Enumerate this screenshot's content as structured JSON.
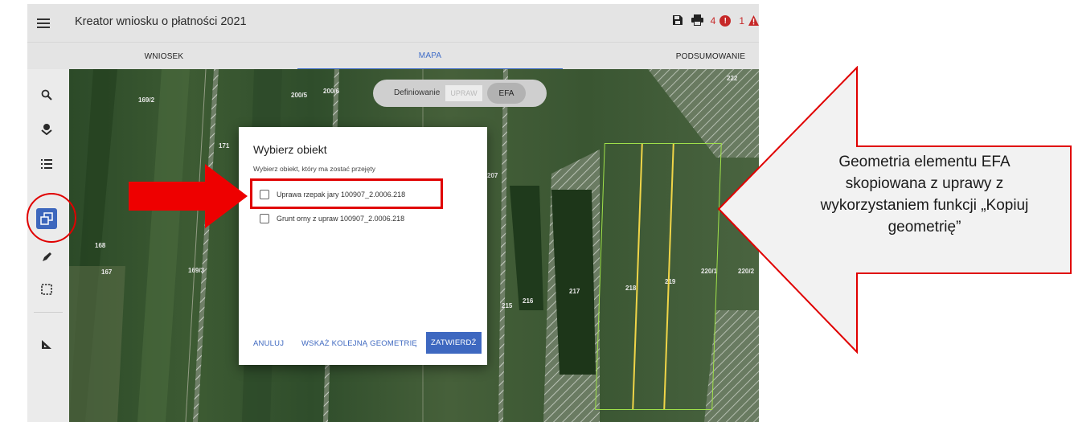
{
  "app": {
    "title": "Kreator wniosku o płatności 2021",
    "counter_errors": "4",
    "counter_warnings": "1",
    "error_color": "#c62828"
  },
  "tabs": [
    {
      "label": "WNIOSEK",
      "active": false
    },
    {
      "label": "MAPA",
      "active": true
    },
    {
      "label": "PODSUMOWANIE",
      "active": false
    }
  ],
  "toolbar": {
    "tools": [
      "search-icon",
      "layers-icon",
      "list-icon",
      "copy-geometry-icon",
      "pencil-icon",
      "select-rectangle-icon",
      "measure-icon"
    ],
    "active_tool": "copy-geometry-icon",
    "accent": "#3d67bd"
  },
  "map": {
    "toggle_label": "Definiowanie",
    "toggle_upraw": "UPRAW",
    "toggle_efa": "EFA",
    "parcel_labels": [
      "169/2",
      "200/5",
      "200/6",
      "222",
      "171",
      "207",
      "168",
      "167",
      "169/3",
      "215",
      "216",
      "217",
      "218",
      "219",
      "220/1",
      "220/2"
    ]
  },
  "dialog": {
    "title": "Wybierz obiekt",
    "subtitle": "Wybierz obiekt, który ma zostać przejęty",
    "options": [
      {
        "label": "Uprawa rzepak jary 100907_2.0006.218",
        "checked": false
      },
      {
        "label": "Grunt orny z upraw 100907_2.0006.218",
        "checked": false
      }
    ],
    "cancel_label": "ANULUJ",
    "next_geometry_label": "WSKAŻ KOLEJNĄ GEOMETRIĘ",
    "confirm_label": "ZATWIERDŹ"
  },
  "annotation": {
    "callout_text": "Geometria elementu EFA skopiowana z uprawy z wykorzystaniem funkcji „Kopiuj geometrię”",
    "highlight_color": "#e00000"
  }
}
